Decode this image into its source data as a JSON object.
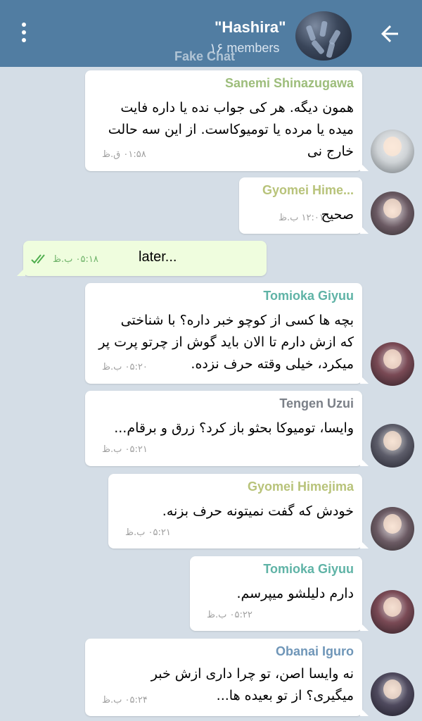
{
  "header": {
    "title": "\"Hashira\"",
    "subtitle": "۱۶ members",
    "watermark": "Fake Chat"
  },
  "colors": {
    "header_bg": "#517da2",
    "chat_bg": "#d4dde6",
    "outgoing_bubble": "#effdde",
    "tick_color": "#4fae4e"
  },
  "icons": {
    "menu": "three-dots-vertical",
    "back": "arrow-left",
    "read_receipt": "double-check"
  },
  "messages": [
    {
      "sender": "Sanemi Shinazugawa",
      "sender_color": "#9dbd7b",
      "lines": [
        "همون دیگه. هر کی جواب نده یا داره فایت",
        "میده یا مرده یا تومیوکاست. از این سه حالت",
        "خارج نی"
      ],
      "time": "۰۱:۵۸ ق.ظ"
    },
    {
      "sender": "Gyomei Hime...",
      "sender_color": "#b8c37a",
      "lines": [
        "صحیح"
      ],
      "time": "۱۲:۰۱ ب.ظ"
    },
    {
      "outgoing": true,
      "text": "later...",
      "time": "۰۵:۱۸ ب.ظ"
    },
    {
      "sender": "Tomioka  Giyuu",
      "sender_color": "#5fb3a6",
      "lines": [
        "بچه ها کسی از کوچو خبر داره؟ با شناختی",
        "که ازش دارم تا الان باید گوش از چرتو پرت پر",
        "میکرد، خیلی وقته حرف نزده."
      ],
      "time": "۰۵:۲۰ ب.ظ"
    },
    {
      "sender": "Tengen Uzui",
      "sender_color": "#7b8088",
      "lines": [
        "وایسا، تومیوکا بحثو باز کرد؟ زرق و برقام..."
      ],
      "time": "۰۵:۲۱ ب.ظ"
    },
    {
      "sender": "Gyomei Himejima",
      "sender_color": "#b8c37a",
      "lines": [
        "خودش که گفت نمیتونه حرف بزنه."
      ],
      "time": "۰۵:۲۱ ب.ظ"
    },
    {
      "sender": "Tomioka  Giyuu",
      "sender_color": "#5fb3a6",
      "lines": [
        "دارم دلیلشو میپرسم."
      ],
      "time": "۰۵:۲۲ ب.ظ"
    },
    {
      "sender": "Obanai Iguro",
      "sender_color": "#6f96b8",
      "lines": [
        "نه وایسا اصن، تو چرا داری ازش خبر",
        "میگیری؟ از تو بعیده ها..."
      ],
      "time": "۰۵:۲۴ ب.ظ"
    }
  ]
}
